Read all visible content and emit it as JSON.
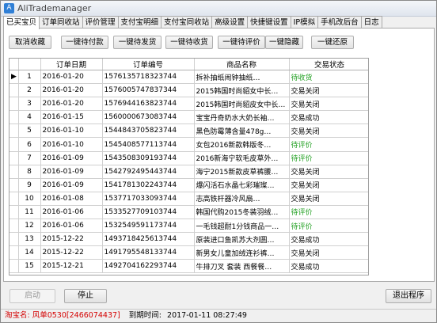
{
  "window": {
    "title": "AliTrademanager",
    "icon": "app-icon"
  },
  "tabs": [
    "已买宝贝",
    "订单同收站",
    "评价管理",
    "支付宝明细",
    "支付宝同收站",
    "高级设置",
    "快捷键设置",
    "IP模拟",
    "手机改后台",
    "日志"
  ],
  "active_tab": 0,
  "toolbar": {
    "buttons": [
      "取消收藏",
      "一键待付款",
      "一键待发货",
      "一键待收货",
      "一键待评价",
      "一键隐藏",
      "一键还原"
    ]
  },
  "grid": {
    "columns": [
      "",
      "",
      "订单日期",
      "订单编号",
      "商品名称",
      "交易状态"
    ],
    "selected_row": 0,
    "rows": [
      {
        "n": "1",
        "date": "2016-01-20",
        "order": "1576135718323744",
        "product": "拆补抽纸闹钟抽纸…",
        "status": "待收货"
      },
      {
        "n": "2",
        "date": "2016-01-20",
        "order": "1576005747837344",
        "product": "2015韩国时尚貂女中长…",
        "status": "交易关闭"
      },
      {
        "n": "3",
        "date": "2016-01-20",
        "order": "1576944163823744",
        "product": "2015韩国时尚貂皮女中长…",
        "status": "交易关闭"
      },
      {
        "n": "4",
        "date": "2016-01-15",
        "order": "1560000673083744",
        "product": "宝宝丹奇奶水大奶长袖…",
        "status": "交易成功"
      },
      {
        "n": "5",
        "date": "2016-01-10",
        "order": "1544843705823744",
        "product": "黑色防霉薄含量478g…",
        "status": "交易关闭"
      },
      {
        "n": "6",
        "date": "2016-01-10",
        "order": "1545408577113744",
        "product": "女包2016新款韩版冬…",
        "status": "待评价"
      },
      {
        "n": "7",
        "date": "2016-01-09",
        "order": "1543508309193744",
        "product": "2016新海宁软毛皮草外…",
        "status": "待评价"
      },
      {
        "n": "8",
        "date": "2016-01-09",
        "order": "1542792495443744",
        "product": "海宁2015新款皮草裤腰…",
        "status": "交易关闭"
      },
      {
        "n": "9",
        "date": "2016-01-09",
        "order": "1541781302243744",
        "product": "爆闪活石水晶七彩璀璨…",
        "status": "交易关闭"
      },
      {
        "n": "10",
        "date": "2016-01-08",
        "order": "1537717033093744",
        "product": "志高铁杆器冷风扇…",
        "status": "交易关闭"
      },
      {
        "n": "11",
        "date": "2016-01-06",
        "order": "1533527709103744",
        "product": "韩国代购2015冬装羽绒…",
        "status": "待评价"
      },
      {
        "n": "12",
        "date": "2016-01-06",
        "order": "1532549591173744",
        "product": "一毛钱超耐1分钱商品一…",
        "status": "待评价"
      },
      {
        "n": "13",
        "date": "2015-12-22",
        "order": "1493718425613744",
        "product": "原装进口鱼凯苏大剂圆…",
        "status": "交易成功"
      },
      {
        "n": "14",
        "date": "2015-12-22",
        "order": "1491795548133744",
        "product": "新男女儿童加绒连衫裤…",
        "status": "交易关闭"
      },
      {
        "n": "15",
        "date": "2015-12-21",
        "order": "1492704162293744",
        "product": "牛排刀叉 套装 西餐餐…",
        "status": "交易成功"
      }
    ]
  },
  "bottom": {
    "start_label": "启动",
    "stop_label": "停止",
    "exit_label": "退出程序"
  },
  "status": {
    "account": "淘宝名: 风单0530[2466074437]",
    "expiry_label": "到期时间:",
    "expiry": "2017-01-11 08:27:49"
  },
  "colors": {
    "status_pending": "#22a022",
    "status_red": "#d40000"
  }
}
